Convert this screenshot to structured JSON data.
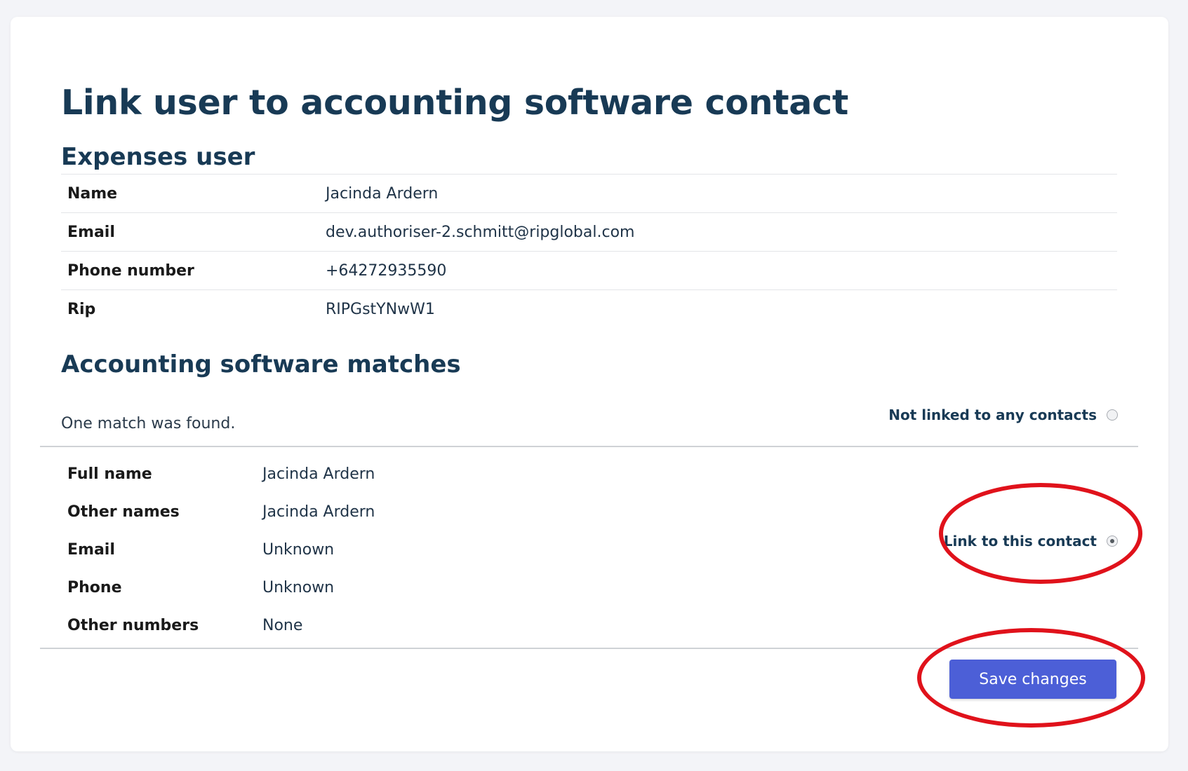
{
  "page": {
    "title": "Link user to accounting software contact"
  },
  "expenses_user": {
    "heading": "Expenses user",
    "rows": [
      {
        "label": "Name",
        "value": "Jacinda Ardern"
      },
      {
        "label": "Email",
        "value": "dev.authoriser-2.schmitt@ripglobal.com"
      },
      {
        "label": "Phone number",
        "value": "+64272935590"
      },
      {
        "label": "Rip",
        "value": "RIPGstYNwW1"
      }
    ]
  },
  "matches": {
    "heading": "Accounting software matches",
    "message": "One match was found.",
    "not_linked_label": "Not linked to any contacts",
    "not_linked_checked": false,
    "contact": {
      "rows": [
        {
          "label": "Full name",
          "value": "Jacinda Ardern"
        },
        {
          "label": "Other names",
          "value": "Jacinda Ardern"
        },
        {
          "label": "Email",
          "value": "Unknown"
        },
        {
          "label": "Phone",
          "value": "Unknown"
        },
        {
          "label": "Other numbers",
          "value": "None"
        }
      ],
      "link_label": "Link to this contact",
      "link_checked": true
    }
  },
  "actions": {
    "save_label": "Save changes"
  },
  "colors": {
    "primary_button": "#4c5fd7",
    "heading": "#183a55",
    "annotation": "#e0121b"
  }
}
